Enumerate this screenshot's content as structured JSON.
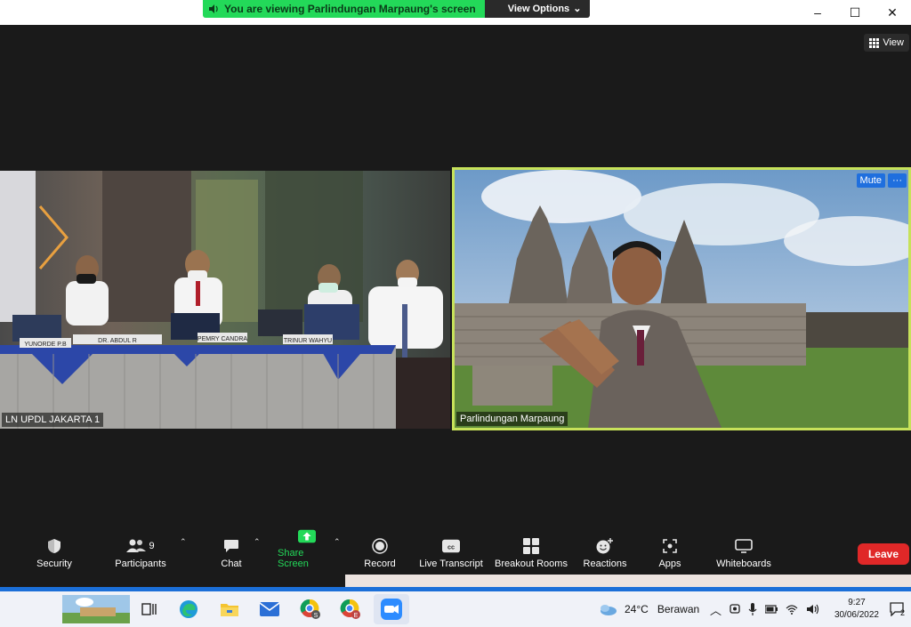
{
  "banner": {
    "viewing_text": "You are viewing Parlindungan Marpaung's screen",
    "view_options_label": "View Options"
  },
  "window_controls": {
    "minimize": "–",
    "maximize": "☐",
    "close": "✕"
  },
  "view_button_label": "View",
  "tiles": {
    "left": {
      "label": "LN UPDL JAKARTA 1",
      "name_plates": [
        "YUNORDE P.B",
        "DR. ABDUL R",
        "PEMRY CANDRA",
        "TRINUR WAHYU"
      ]
    },
    "right": {
      "label": "Parlindungan Marpaung",
      "mute_label": "Mute",
      "more_label": "···"
    }
  },
  "toolbar": {
    "security": "Security",
    "participants": "Participants",
    "participants_count": "9",
    "chat": "Chat",
    "share_screen": "Share Screen",
    "record": "Record",
    "live_transcript": "Live Transcript",
    "breakout_rooms": "Breakout Rooms",
    "reactions": "Reactions",
    "apps": "Apps",
    "whiteboards": "Whiteboards",
    "leave": "Leave"
  },
  "taskbar": {
    "weather_temp": "24°C",
    "weather_desc": "Berawan",
    "time": "9:27",
    "date": "30/06/2022",
    "notification_count": "2"
  },
  "colors": {
    "banner_green": "#23d959",
    "active_speaker_border": "#c7e25a",
    "leave_red": "#e02828",
    "mute_blue": "#1f6fde",
    "taskbar_blue_line": "#1b6fd8"
  }
}
